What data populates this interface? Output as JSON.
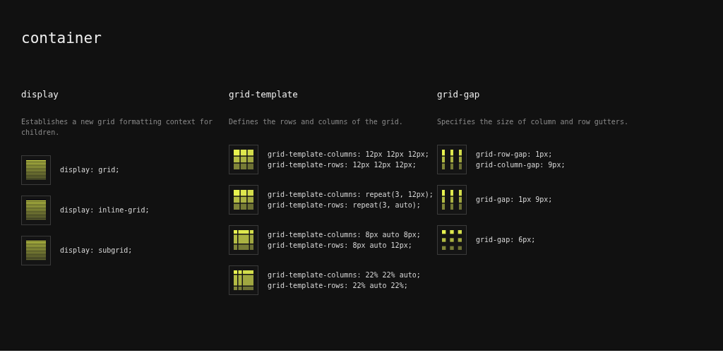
{
  "title": "container",
  "sections": [
    {
      "heading": "display",
      "description": "Establishes a new grid formatting context for children.",
      "items": [
        {
          "kind": "lines",
          "code": [
            "display: grid;"
          ]
        },
        {
          "kind": "lines",
          "code": [
            "display: inline-grid;"
          ]
        },
        {
          "kind": "lines",
          "code": [
            "display: subgrid;"
          ]
        }
      ]
    },
    {
      "heading": "grid-template",
      "description": "Defines the rows and columns of the grid.",
      "items": [
        {
          "kind": "even",
          "code": [
            "grid-template-columns: 12px 12px 12px;",
            "grid-template-rows: 12px 12px 12px;"
          ]
        },
        {
          "kind": "even",
          "code": [
            "grid-template-columns: repeat(3, 12px);",
            "grid-template-rows: repeat(3, auto);"
          ]
        },
        {
          "kind": "framed",
          "code": [
            "grid-template-columns: 8px auto 8px;",
            "grid-template-rows: 8px auto 12px;"
          ]
        },
        {
          "kind": "split",
          "code": [
            "grid-template-columns: 22% 22% auto;",
            "grid-template-rows: 22% auto 22%;"
          ]
        }
      ]
    },
    {
      "heading": "grid-gap",
      "description": "Specifies the size of column and row gutters.",
      "items": [
        {
          "kind": "columns",
          "code": [
            "grid-row-gap: 1px;",
            "grid-column-gap: 9px;"
          ]
        },
        {
          "kind": "columns",
          "code": [
            "grid-gap: 1px 9px;"
          ]
        },
        {
          "kind": "dots",
          "code": [
            "grid-gap: 6px;"
          ]
        }
      ]
    }
  ]
}
